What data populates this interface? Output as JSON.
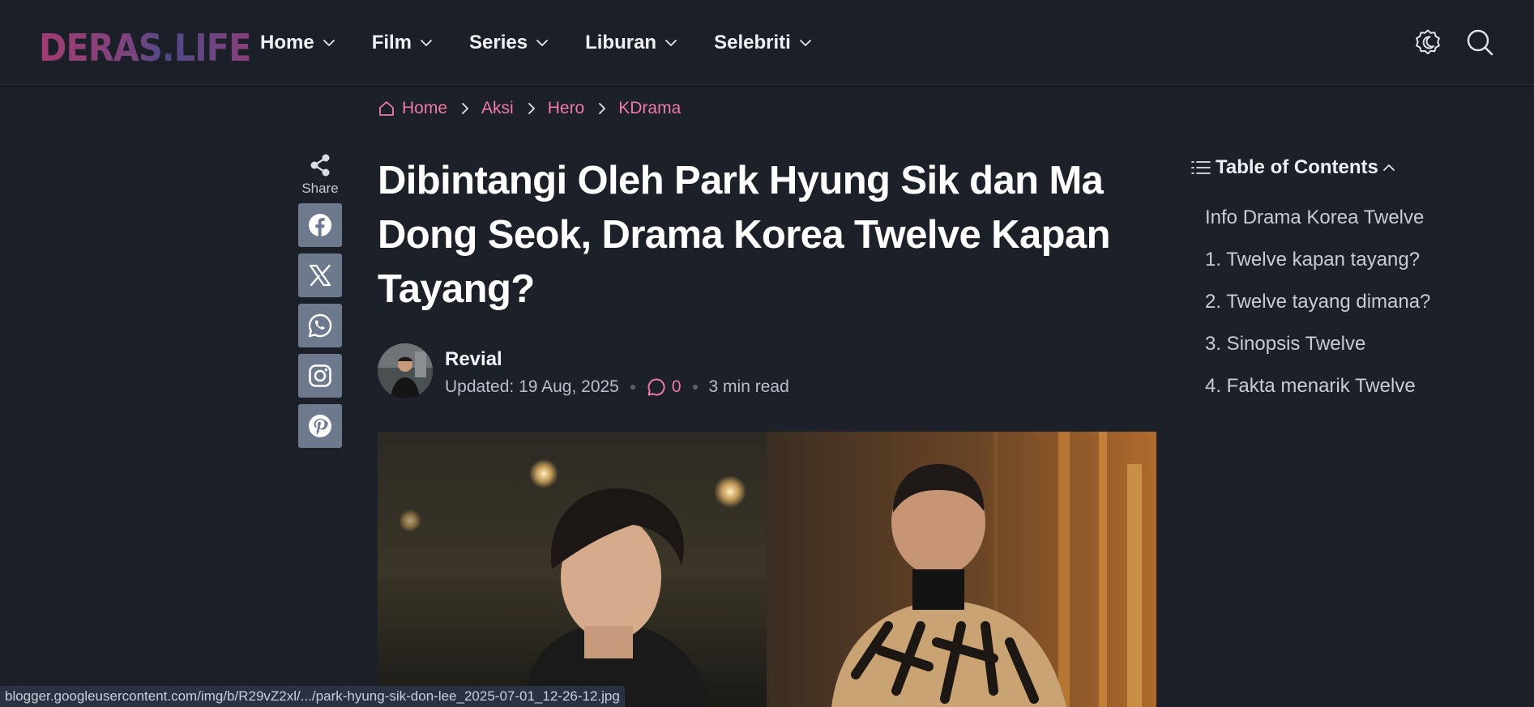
{
  "header": {
    "logo": "DERAS.LIFE",
    "nav": [
      {
        "label": "Home"
      },
      {
        "label": "Film"
      },
      {
        "label": "Series"
      },
      {
        "label": "Liburan"
      },
      {
        "label": "Selebriti"
      }
    ],
    "icons": [
      "theme-toggle-icon",
      "search-icon"
    ]
  },
  "breadcrumb": [
    "Home",
    "Aksi",
    "Hero",
    "KDrama"
  ],
  "share": {
    "label": "Share",
    "buttons": [
      "facebook",
      "x",
      "whatsapp",
      "instagram",
      "pinterest"
    ]
  },
  "article": {
    "title": "Dibintangi Oleh Park Hyung Sik dan Ma Dong Seok, Drama Korea Twelve Kapan Tayang?",
    "author": "Revial",
    "updated": "Updated: 19 Aug, 2025",
    "comments": "0",
    "read_time": "3 min read"
  },
  "toc": {
    "title": "Table of Contents",
    "items": [
      "Info Drama Korea Twelve",
      "1. Twelve kapan tayang?",
      "2. Twelve tayang dimana?",
      "3. Sinopsis Twelve",
      "4. Fakta menarik Twelve"
    ]
  },
  "status_url": "blogger.googleusercontent.com/img/b/R29vZ2xl/.../park-hyung-sik-don-lee_2025-07-01_12-26-12.jpg",
  "colors": {
    "accent": "#f07aa6",
    "background": "#1c2028",
    "share_button": "#6d7a8e"
  }
}
